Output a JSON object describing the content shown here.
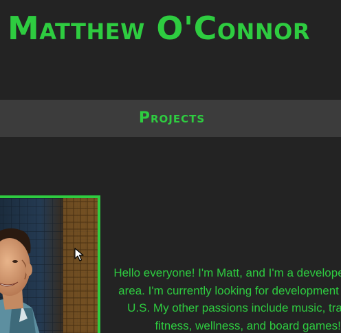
{
  "header": {
    "site_title": "Matthew O'Connor"
  },
  "nav": {
    "items": [
      {
        "label": "Projects"
      }
    ]
  },
  "main": {
    "bio_lines": [
      "Hello everyone! I'm Matt, and I'm a developer in the Bay",
      "area. I'm currently looking for development work in the",
      "U.S. My other passions include music, travel, food,",
      "fitness, wellness, and board games! I've"
    ]
  },
  "colors": {
    "accent": "#2ecc40",
    "background": "#232323",
    "nav_background": "#3c3c3c"
  },
  "icons": {
    "cursor": "mouse-pointer-icon"
  }
}
